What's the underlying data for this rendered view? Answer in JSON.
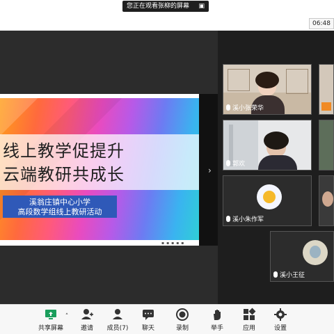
{
  "top": {
    "sharing_notice": "您正在观看张柳的屏幕",
    "time": "06:48"
  },
  "slide": {
    "title_line1": "线上教学促提升",
    "title_line2": "云端教研共成长",
    "school": "溪翁庄镇中心小学",
    "activity": "高段数学组线上教研活动"
  },
  "participants": [
    {
      "name": "溪小张荣华"
    },
    {
      "name": "郭欢"
    },
    {
      "name": "溪小朱作军"
    },
    {
      "name": "溪小王征"
    }
  ],
  "toolbar": {
    "share": "共享屏幕",
    "invite": "邀请",
    "members": "成员(7)",
    "chat": "聊天",
    "record": "录制",
    "raise": "举手",
    "apps": "应用",
    "settings": "设置"
  },
  "colors": {
    "accent_orange": "#f08a24",
    "slide_blue": "#2f59b8",
    "dark_bg": "#2c2c2c"
  }
}
